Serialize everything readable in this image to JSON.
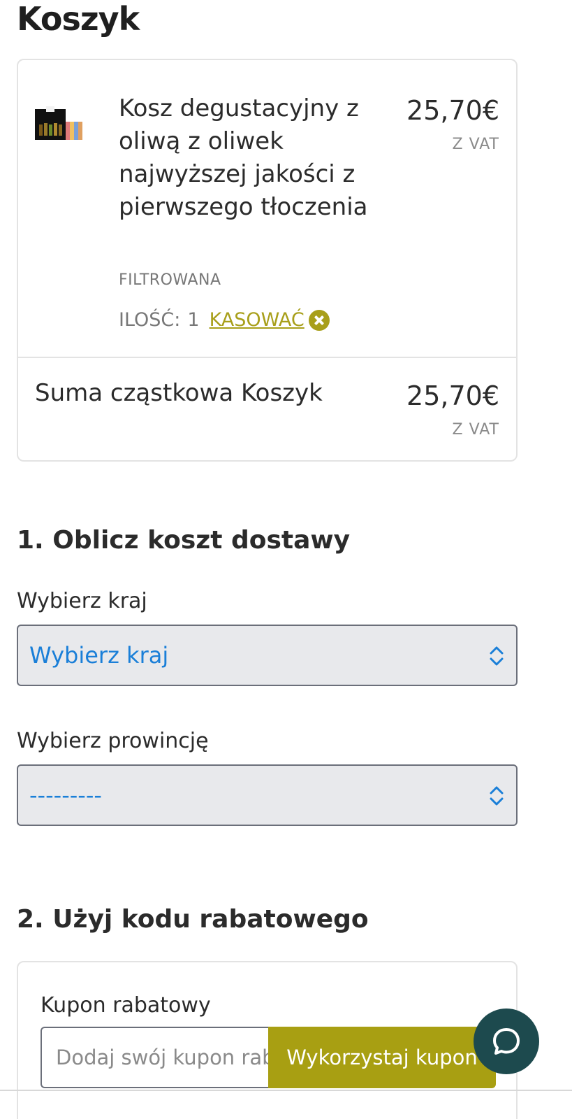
{
  "page": {
    "title": "Koszyk"
  },
  "cart": {
    "item": {
      "name": "Kosz degustacyjny z oliwą z oliwek najwyższej jakości z pierwszego tłoczenia",
      "variant": "FILTROWANA",
      "price": "25,70€",
      "vat_note": "Z VAT",
      "quantity_label": "ILOŚĆ:",
      "quantity": "1",
      "remove_label": "KASOWAĆ"
    },
    "subtotal": {
      "label": "Suma cząstkowa Koszyk",
      "price": "25,70€",
      "vat_note": "Z VAT"
    }
  },
  "shipping": {
    "heading": "1. Oblicz koszt dostawy",
    "country_label": "Wybierz kraj",
    "country_value": "Wybierz kraj",
    "province_label": "Wybierz prowincję",
    "province_value": "---------"
  },
  "coupon": {
    "heading": "2. Użyj kodu rabatowego",
    "label": "Kupon rabatowy",
    "placeholder": "Dodaj swój kupon rabatowy",
    "button_label": "Wykorzystaj kupon"
  },
  "colors": {
    "accent": "#a89f12",
    "select_text": "#1a7fd8",
    "chat_button": "#1d4a4e"
  },
  "icons": {
    "remove": "close-circle-icon",
    "select": "chevron-up-down-icon",
    "chat": "chat-bubble-icon"
  }
}
